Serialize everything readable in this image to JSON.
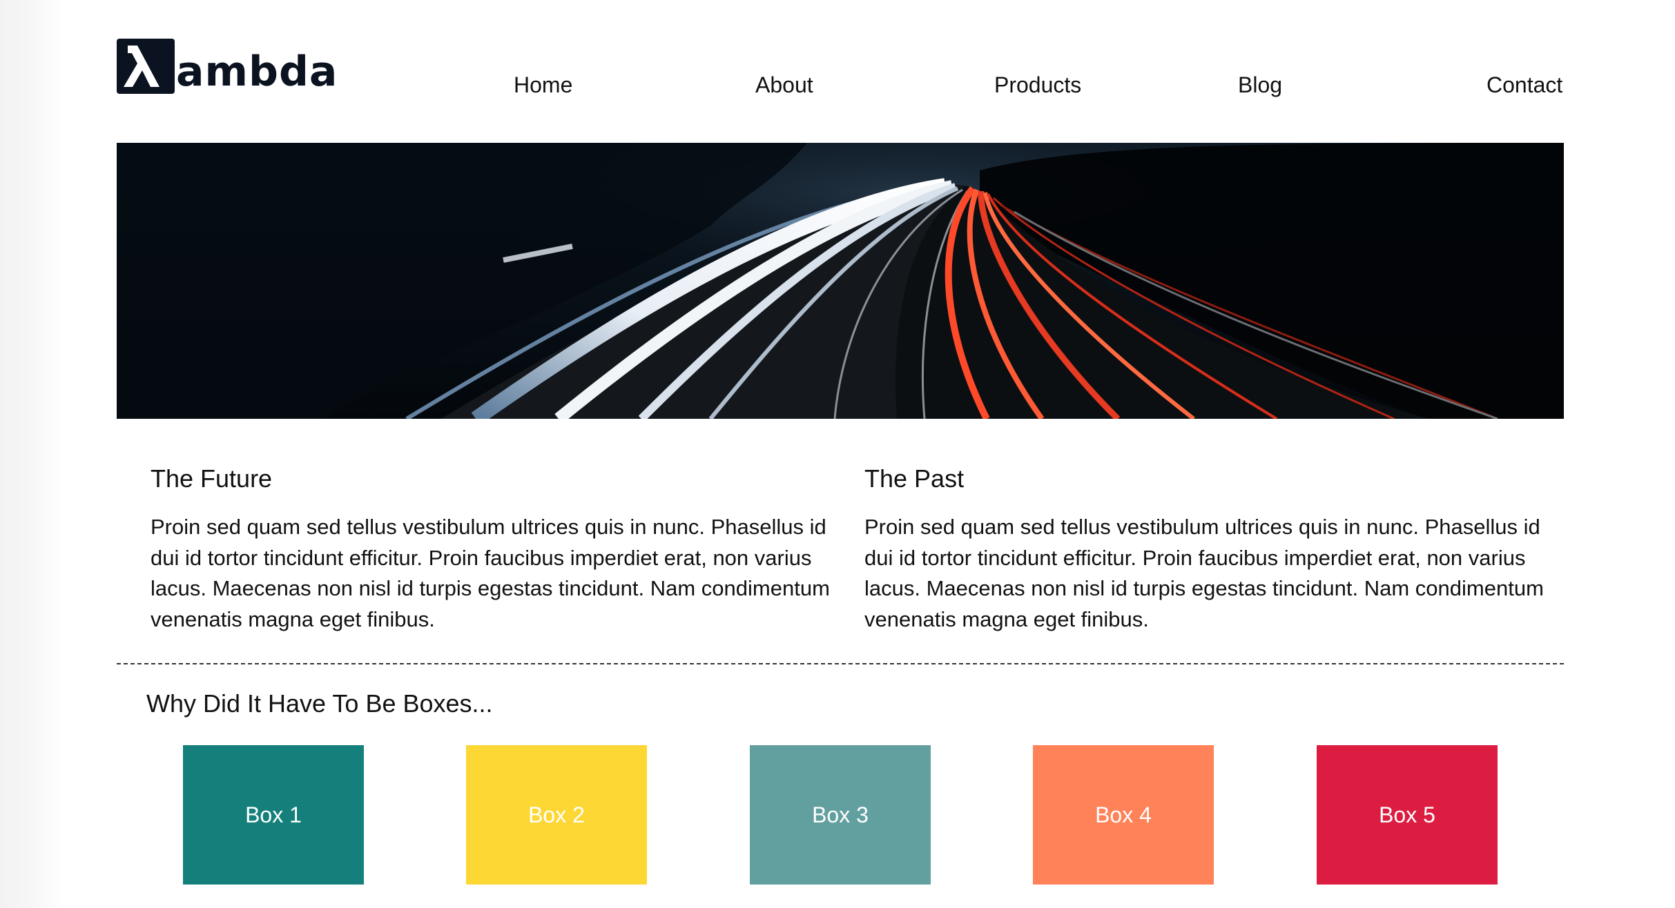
{
  "brand": {
    "logo_glyph": "λ",
    "logo_text": "ambda",
    "logo_color": "#0b1220"
  },
  "nav": {
    "items": [
      {
        "label": "Home"
      },
      {
        "label": "About"
      },
      {
        "label": "Products"
      },
      {
        "label": "Blog"
      },
      {
        "label": "Contact"
      }
    ]
  },
  "hero": {
    "image": "night-highway-light-trails"
  },
  "sections": [
    {
      "title": "The Future",
      "body": "Proin sed quam sed tellus vestibulum ultrices quis in nunc. Phasellus id dui id tortor tincidunt efficitur. Proin faucibus imperdiet erat, non varius lacus. Maecenas non nisl id turpis egestas tincidunt. Nam condimentum venenatis magna eget finibus."
    },
    {
      "title": "The Past",
      "body": "Proin sed quam sed tellus vestibulum ultrices quis in nunc. Phasellus id dui id tortor tincidunt efficitur. Proin faucibus imperdiet erat, non varius lacus. Maecenas non nisl id turpis egestas tincidunt. Nam condimentum venenatis magna eget finibus."
    }
  ],
  "boxes": {
    "title": "Why Did It Have To Be Boxes...",
    "items": [
      {
        "label": "Box 1",
        "color": "#15807b"
      },
      {
        "label": "Box 2",
        "color": "#fdd734"
      },
      {
        "label": "Box 3",
        "color": "#62a09f"
      },
      {
        "label": "Box 4",
        "color": "#ff8258"
      },
      {
        "label": "Box 5",
        "color": "#dc1d41"
      }
    ]
  }
}
